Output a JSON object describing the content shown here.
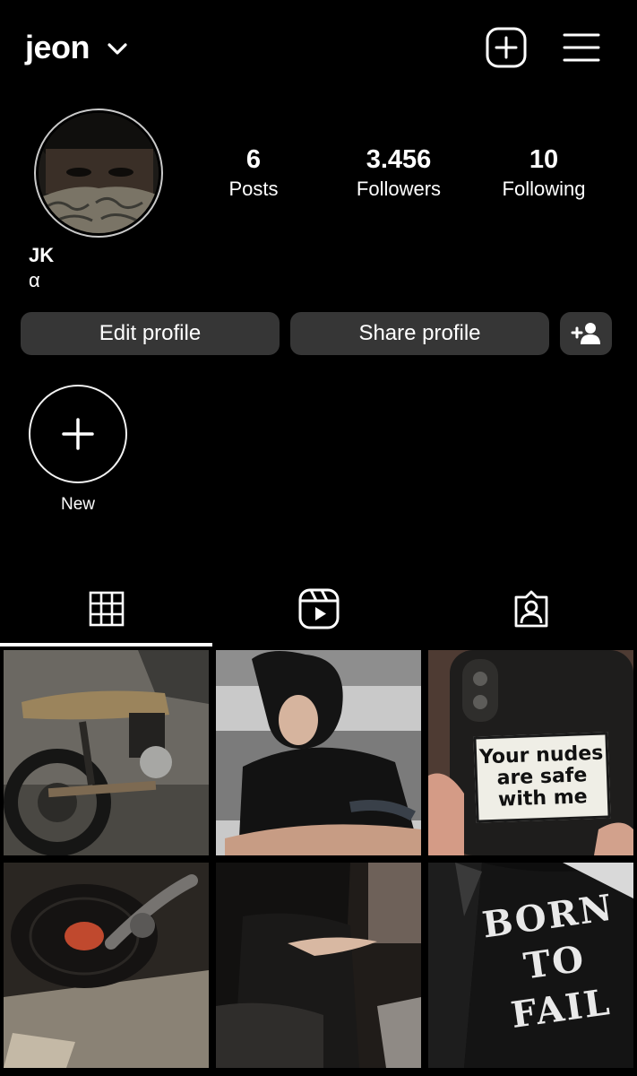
{
  "header": {
    "username": "jeon",
    "add_icon": "plus-square-icon",
    "menu_icon": "hamburger-menu-icon"
  },
  "profile": {
    "display_name": "JK",
    "bio": "α",
    "stats": [
      {
        "value": "6",
        "label": "Posts"
      },
      {
        "value": "3.456",
        "label": "Followers"
      },
      {
        "value": "10",
        "label": "Following"
      }
    ]
  },
  "actions": {
    "edit_label": "Edit profile",
    "share_label": "Share profile",
    "add_user_icon": "add-person-icon"
  },
  "highlights": {
    "new_label": "New"
  },
  "tabs": [
    {
      "icon": "grid-icon",
      "active": true
    },
    {
      "icon": "reels-icon",
      "active": false
    },
    {
      "icon": "tagged-person-icon",
      "active": false
    }
  ],
  "posts": {
    "sign_text": "Your nudes are safe with me",
    "jacket_text": "BORN TO FAIL"
  },
  "colors": {
    "background": "#000000",
    "button": "#363636",
    "text": "#ffffff"
  }
}
